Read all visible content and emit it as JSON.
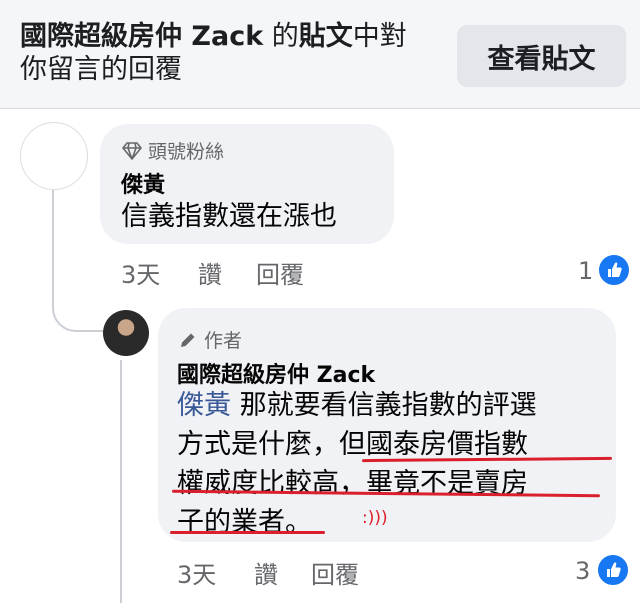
{
  "header": {
    "title_bold_1": "國際超級房仲 Zack",
    "title_light_1": " 的",
    "title_bold_2": "貼文",
    "title_light_2": "中對你留言的回覆",
    "view_post_label": "查看貼文"
  },
  "comment1": {
    "badge_icon": "diamond-icon",
    "badge": "頭號粉絲",
    "author": "傑黃",
    "text": "信義指數還在漲也",
    "time": "3天",
    "like": "讚",
    "reply": "回覆",
    "reaction_count": "1"
  },
  "reply1": {
    "badge_icon": "pencil-icon",
    "badge": "作者",
    "author": "國際超級房仲 Zack",
    "mention": "傑黃",
    "line1": " 那就要看信義指數的評選",
    "line2": "方式是什麼，但國泰房價指數",
    "line3": "權威度比較高，畢竟不是賣房",
    "line4": "子的業者。",
    "annotation": ":)))",
    "time": "3天",
    "like": "讚",
    "reply": "回覆",
    "reaction_count": "3"
  },
  "colors": {
    "accent": "#1877f2",
    "mention": "#385898",
    "underline": "#d9202c"
  }
}
